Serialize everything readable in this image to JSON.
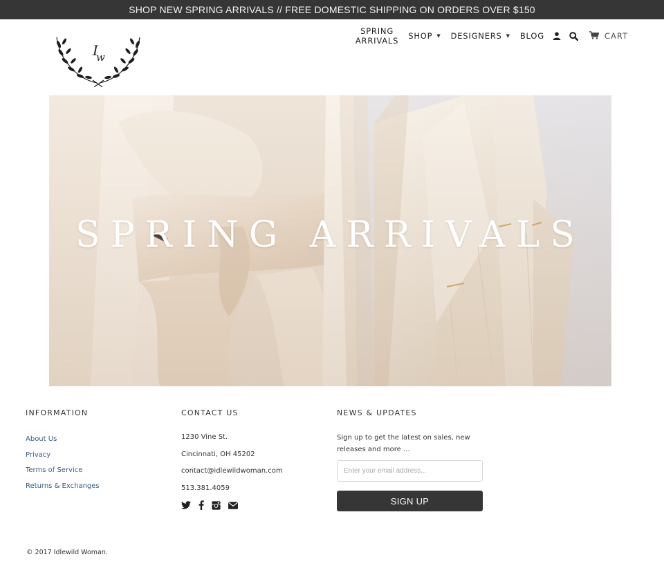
{
  "announcement": "SHOP NEW SPRING ARRIVALS // FREE DOMESTIC SHIPPING ON ORDERS OVER $150",
  "logo": {
    "monogram": "IW",
    "icon": "laurel-wreath-logo"
  },
  "nav": {
    "spring_line1": "SPRING",
    "spring_line2": "ARRIVALS",
    "shop": "SHOP",
    "designers": "DESIGNERS",
    "blog": "BLOG",
    "caret": "▼",
    "account_icon": "person-icon",
    "search_icon": "search-icon",
    "cart_icon": "cart-icon",
    "cart": "CART"
  },
  "hero": {
    "title": "SPRING ARRIVALS"
  },
  "footer": {
    "information": {
      "heading": "INFORMATION",
      "links": [
        "About Us",
        "Privacy",
        "Terms of Service",
        "Returns & Exchanges"
      ]
    },
    "contact": {
      "heading": "CONTACT US",
      "address": "1230 Vine St.",
      "city": "Cincinnati, OH 45202",
      "email": "contact@idlewildwoman.com",
      "phone": "513.381.4059",
      "social_icons": [
        "twitter-icon",
        "facebook-icon",
        "instagram-icon",
        "email-icon"
      ]
    },
    "news": {
      "heading": "NEWS & UPDATES",
      "text": "Sign up to get the latest on sales, new releases and more …",
      "placeholder": "Enter your email address...",
      "button": "SIGN UP"
    }
  },
  "copyright": "© 2017 Idlewild Woman.",
  "colors": {
    "bar": "#363636",
    "link": "#3a5a85",
    "background": "#ffffff"
  }
}
